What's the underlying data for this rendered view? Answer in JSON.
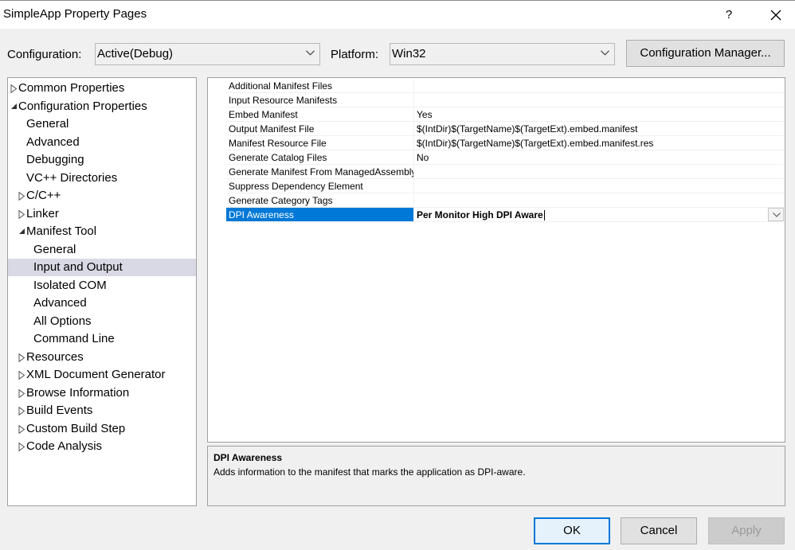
{
  "window": {
    "title": "SimpleApp Property Pages",
    "help_label": "?",
    "close_icon": "close-icon"
  },
  "config": {
    "configuration_label": "Configuration:",
    "configuration_value": "Active(Debug)",
    "platform_label": "Platform:",
    "platform_value": "Win32",
    "manager_button": "Configuration Manager..."
  },
  "tree": {
    "items": [
      {
        "label": "Common Properties",
        "level": 0,
        "expander": "collapsed"
      },
      {
        "label": "Configuration Properties",
        "level": 0,
        "expander": "expanded"
      },
      {
        "label": "General",
        "level": 1,
        "expander": "none"
      },
      {
        "label": "Advanced",
        "level": 1,
        "expander": "none"
      },
      {
        "label": "Debugging",
        "level": 1,
        "expander": "none"
      },
      {
        "label": "VC++ Directories",
        "level": 1,
        "expander": "none"
      },
      {
        "label": "C/C++",
        "level": 1,
        "expander": "collapsed"
      },
      {
        "label": "Linker",
        "level": 1,
        "expander": "collapsed"
      },
      {
        "label": "Manifest Tool",
        "level": 1,
        "expander": "expanded"
      },
      {
        "label": "General",
        "level": 2,
        "expander": "none"
      },
      {
        "label": "Input and Output",
        "level": 2,
        "expander": "none",
        "selected": true
      },
      {
        "label": "Isolated COM",
        "level": 2,
        "expander": "none"
      },
      {
        "label": "Advanced",
        "level": 2,
        "expander": "none"
      },
      {
        "label": "All Options",
        "level": 2,
        "expander": "none"
      },
      {
        "label": "Command Line",
        "level": 2,
        "expander": "none"
      },
      {
        "label": "Resources",
        "level": 1,
        "expander": "collapsed"
      },
      {
        "label": "XML Document Generator",
        "level": 1,
        "expander": "collapsed"
      },
      {
        "label": "Browse Information",
        "level": 1,
        "expander": "collapsed"
      },
      {
        "label": "Build Events",
        "level": 1,
        "expander": "collapsed"
      },
      {
        "label": "Custom Build Step",
        "level": 1,
        "expander": "collapsed"
      },
      {
        "label": "Code Analysis",
        "level": 1,
        "expander": "collapsed"
      }
    ]
  },
  "properties": {
    "rows": [
      {
        "name": "Additional Manifest Files",
        "value": ""
      },
      {
        "name": "Input Resource Manifests",
        "value": ""
      },
      {
        "name": "Embed Manifest",
        "value": "Yes"
      },
      {
        "name": "Output Manifest File",
        "value": "$(IntDir)$(TargetName)$(TargetExt).embed.manifest"
      },
      {
        "name": "Manifest Resource File",
        "value": "$(IntDir)$(TargetName)$(TargetExt).embed.manifest.res"
      },
      {
        "name": "Generate Catalog Files",
        "value": "No"
      },
      {
        "name": "Generate Manifest From ManagedAssembly",
        "value": ""
      },
      {
        "name": "Suppress Dependency Element",
        "value": ""
      },
      {
        "name": "Generate Category Tags",
        "value": ""
      },
      {
        "name": "DPI Awareness",
        "value": "Per Monitor High DPI Aware",
        "selected": true
      }
    ]
  },
  "description": {
    "title": "DPI Awareness",
    "text": "Adds information to the manifest that marks the application as DPI-aware."
  },
  "buttons": {
    "ok": "OK",
    "cancel": "Cancel",
    "apply": "Apply"
  },
  "colors": {
    "selection_blue": "#0078d7",
    "tree_selection": "#d9d9e5",
    "window_bg": "#f0f0f0"
  }
}
